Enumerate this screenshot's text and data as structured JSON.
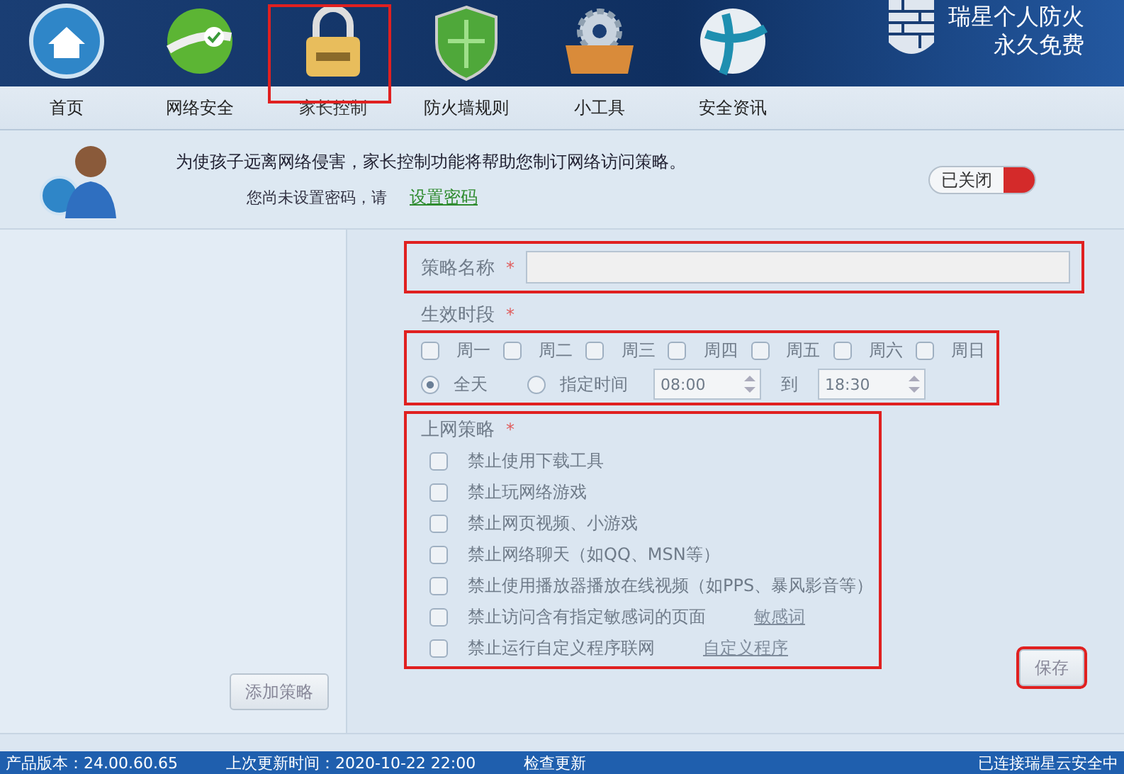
{
  "nav": [
    {
      "label": "首页",
      "selected": false
    },
    {
      "label": "网络安全",
      "selected": false
    },
    {
      "label": "家长控制",
      "selected": true
    },
    {
      "label": "防火墙规则",
      "selected": false
    },
    {
      "label": "小工具",
      "selected": false
    },
    {
      "label": "安全资讯",
      "selected": false
    }
  ],
  "brand": {
    "line1": "瑞星个人防火",
    "line2": "永久免费"
  },
  "intro": {
    "message": "为使孩子远离网络侵害，家长控制功能将帮助您制订网络访问策略。",
    "password_note": "您尚未设置密码，请",
    "password_link": "设置密码",
    "toggle": {
      "label": "已关闭",
      "on": false
    }
  },
  "sidebar": {
    "add_button": "添加策略"
  },
  "form": {
    "disabled": true,
    "name_label": "策略名称",
    "required_mark": "*",
    "period_label": "生效时段",
    "days": [
      {
        "label": "周一",
        "checked": false
      },
      {
        "label": "周二",
        "checked": false
      },
      {
        "label": "周三",
        "checked": false
      },
      {
        "label": "周四",
        "checked": false
      },
      {
        "label": "周五",
        "checked": false
      },
      {
        "label": "周六",
        "checked": false
      },
      {
        "label": "周日",
        "checked": false
      }
    ],
    "time_modes": [
      {
        "label": "全天",
        "selected": true
      },
      {
        "label": "指定时间",
        "selected": false
      }
    ],
    "start_time": "08:00",
    "to_label": "到",
    "end_time": "18:30",
    "policy_label": "上网策略",
    "policies": [
      {
        "label": "禁止使用下载工具",
        "checked": false
      },
      {
        "label": "禁止玩网络游戏",
        "checked": false
      },
      {
        "label": "禁止网页视频、小游戏",
        "checked": false
      },
      {
        "label": "禁止网络聊天（如QQ、MSN等）",
        "checked": false
      },
      {
        "label": "禁止使用播放器播放在线视频（如PPS、暴风影音等）",
        "checked": false
      },
      {
        "label": "禁止访问含有指定敏感词的页面",
        "checked": false,
        "link": "敏感词"
      },
      {
        "label": "禁止运行自定义程序联网",
        "checked": false,
        "link": "自定义程序"
      }
    ],
    "save_button": "保存"
  },
  "status_bar": {
    "version": "产品版本：24.00.60.65",
    "updated": "上次更新时间：2020-10-22 22:00",
    "check_update": "检查更新",
    "cloud": "已连接瑞星云安全中"
  }
}
